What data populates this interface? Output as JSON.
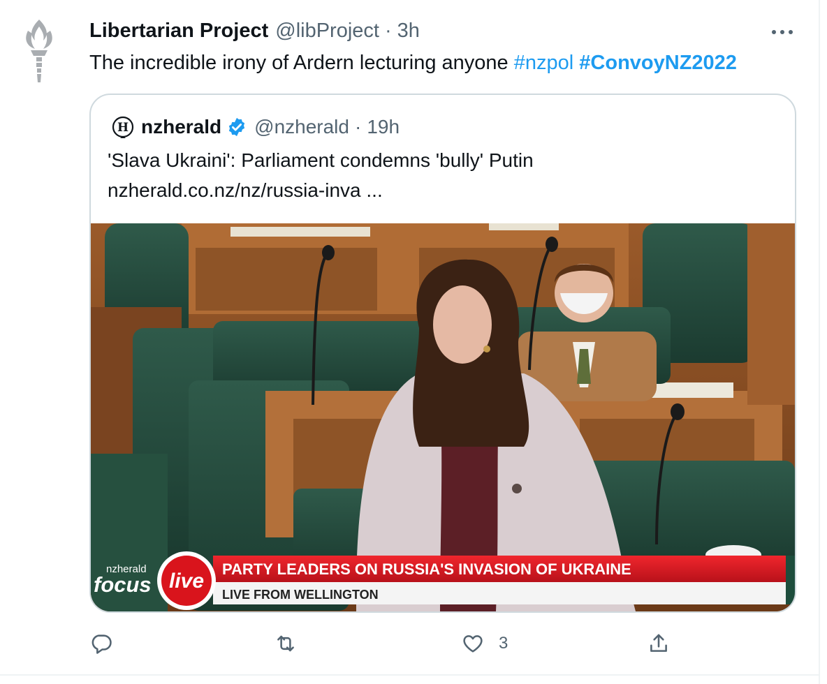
{
  "tweet": {
    "author_name": "Libertarian Project",
    "author_handle": "@libProject",
    "separator": "·",
    "time": "3h",
    "more_icon": "more-horizontal-icon",
    "text_prefix": "The incredible irony of Ardern lecturing anyone ",
    "hashtags": [
      "#nzpol",
      "#ConvoyNZ2022"
    ]
  },
  "quoted": {
    "author_name": "nzherald",
    "author_handle": "@nzherald",
    "separator": "·",
    "time": "19h",
    "verified_icon": "verified-badge-icon",
    "text": "'Slava Ukraini': Parliament condemns 'bully' Putin",
    "link": "nzherald.co.nz/nz/russia-inva ...",
    "media": {
      "description_icon": "video-thumbnail",
      "logo_small": "nzherald",
      "logo_focus": "focus",
      "logo_live": "live",
      "lower_third_headline": "PARTY LEADERS ON RUSSIA'S INVASION OF UKRAINE",
      "lower_third_sub": "LIVE FROM WELLINGTON"
    }
  },
  "actions": {
    "reply_icon": "reply-icon",
    "retweet_icon": "retweet-icon",
    "like_icon": "heart-icon",
    "like_count": "3",
    "share_icon": "share-icon"
  },
  "colors": {
    "accent": "#1d9bf0",
    "secondary_text": "#536471",
    "border": "#cfd9de",
    "lower_third_red": "#d9141c"
  }
}
